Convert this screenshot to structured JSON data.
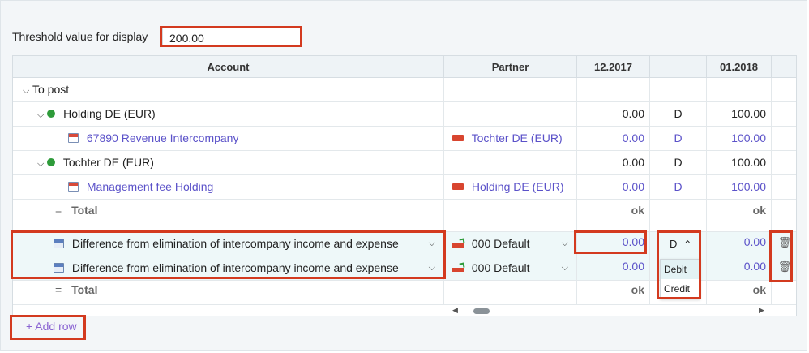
{
  "threshold": {
    "label": "Threshold value for display",
    "value": "200.00"
  },
  "columns": {
    "account": "Account",
    "partner": "Partner",
    "p1": "12.2017",
    "p2": "",
    "p3": "01.2018"
  },
  "rows": {
    "to_post": "To post",
    "holding": {
      "name": "Holding DE (EUR)",
      "v1": "0.00",
      "dc": "D",
      "v3": "100.00"
    },
    "holding_acct": {
      "name": "67890 Revenue Intercompany",
      "partner": "Tochter DE (EUR)",
      "v1": "0.00",
      "dc": "D",
      "v3": "100.00"
    },
    "tochter": {
      "name": "Tochter DE (EUR)",
      "v1": "0.00",
      "dc": "D",
      "v3": "100.00"
    },
    "tochter_acct": {
      "name": "Management fee Holding",
      "partner": "Holding DE (EUR)",
      "v1": "0.00",
      "dc": "D",
      "v3": "100.00"
    },
    "total1": {
      "label": "Total",
      "sym": "=",
      "v1": "ok",
      "v3": "ok"
    },
    "diff1": {
      "name": "Difference from elimination of intercompany income and expense",
      "partner": "000 Default",
      "v1": "0.00",
      "dc": "D",
      "v3": "0.00"
    },
    "diff2": {
      "name": "Difference from elimination of intercompany income and expense",
      "partner": "000 Default",
      "v1": "0.00",
      "v3": "0.00"
    },
    "total2": {
      "label": "Total",
      "sym": "=",
      "v1": "ok",
      "v3": "ok"
    }
  },
  "dc_options": [
    "Debit",
    "Credit"
  ],
  "add_row": "+ Add row",
  "icons": [
    "chevron-down-icon",
    "chevron-up-icon",
    "status-dot-icon",
    "account-icon",
    "flag-icon",
    "trash-icon",
    "scroll-left-icon",
    "scroll-right-icon"
  ],
  "colors": {
    "accent": "#5b52c9",
    "highlight_box": "#d33a1f",
    "status_green": "#2e9b3a"
  }
}
